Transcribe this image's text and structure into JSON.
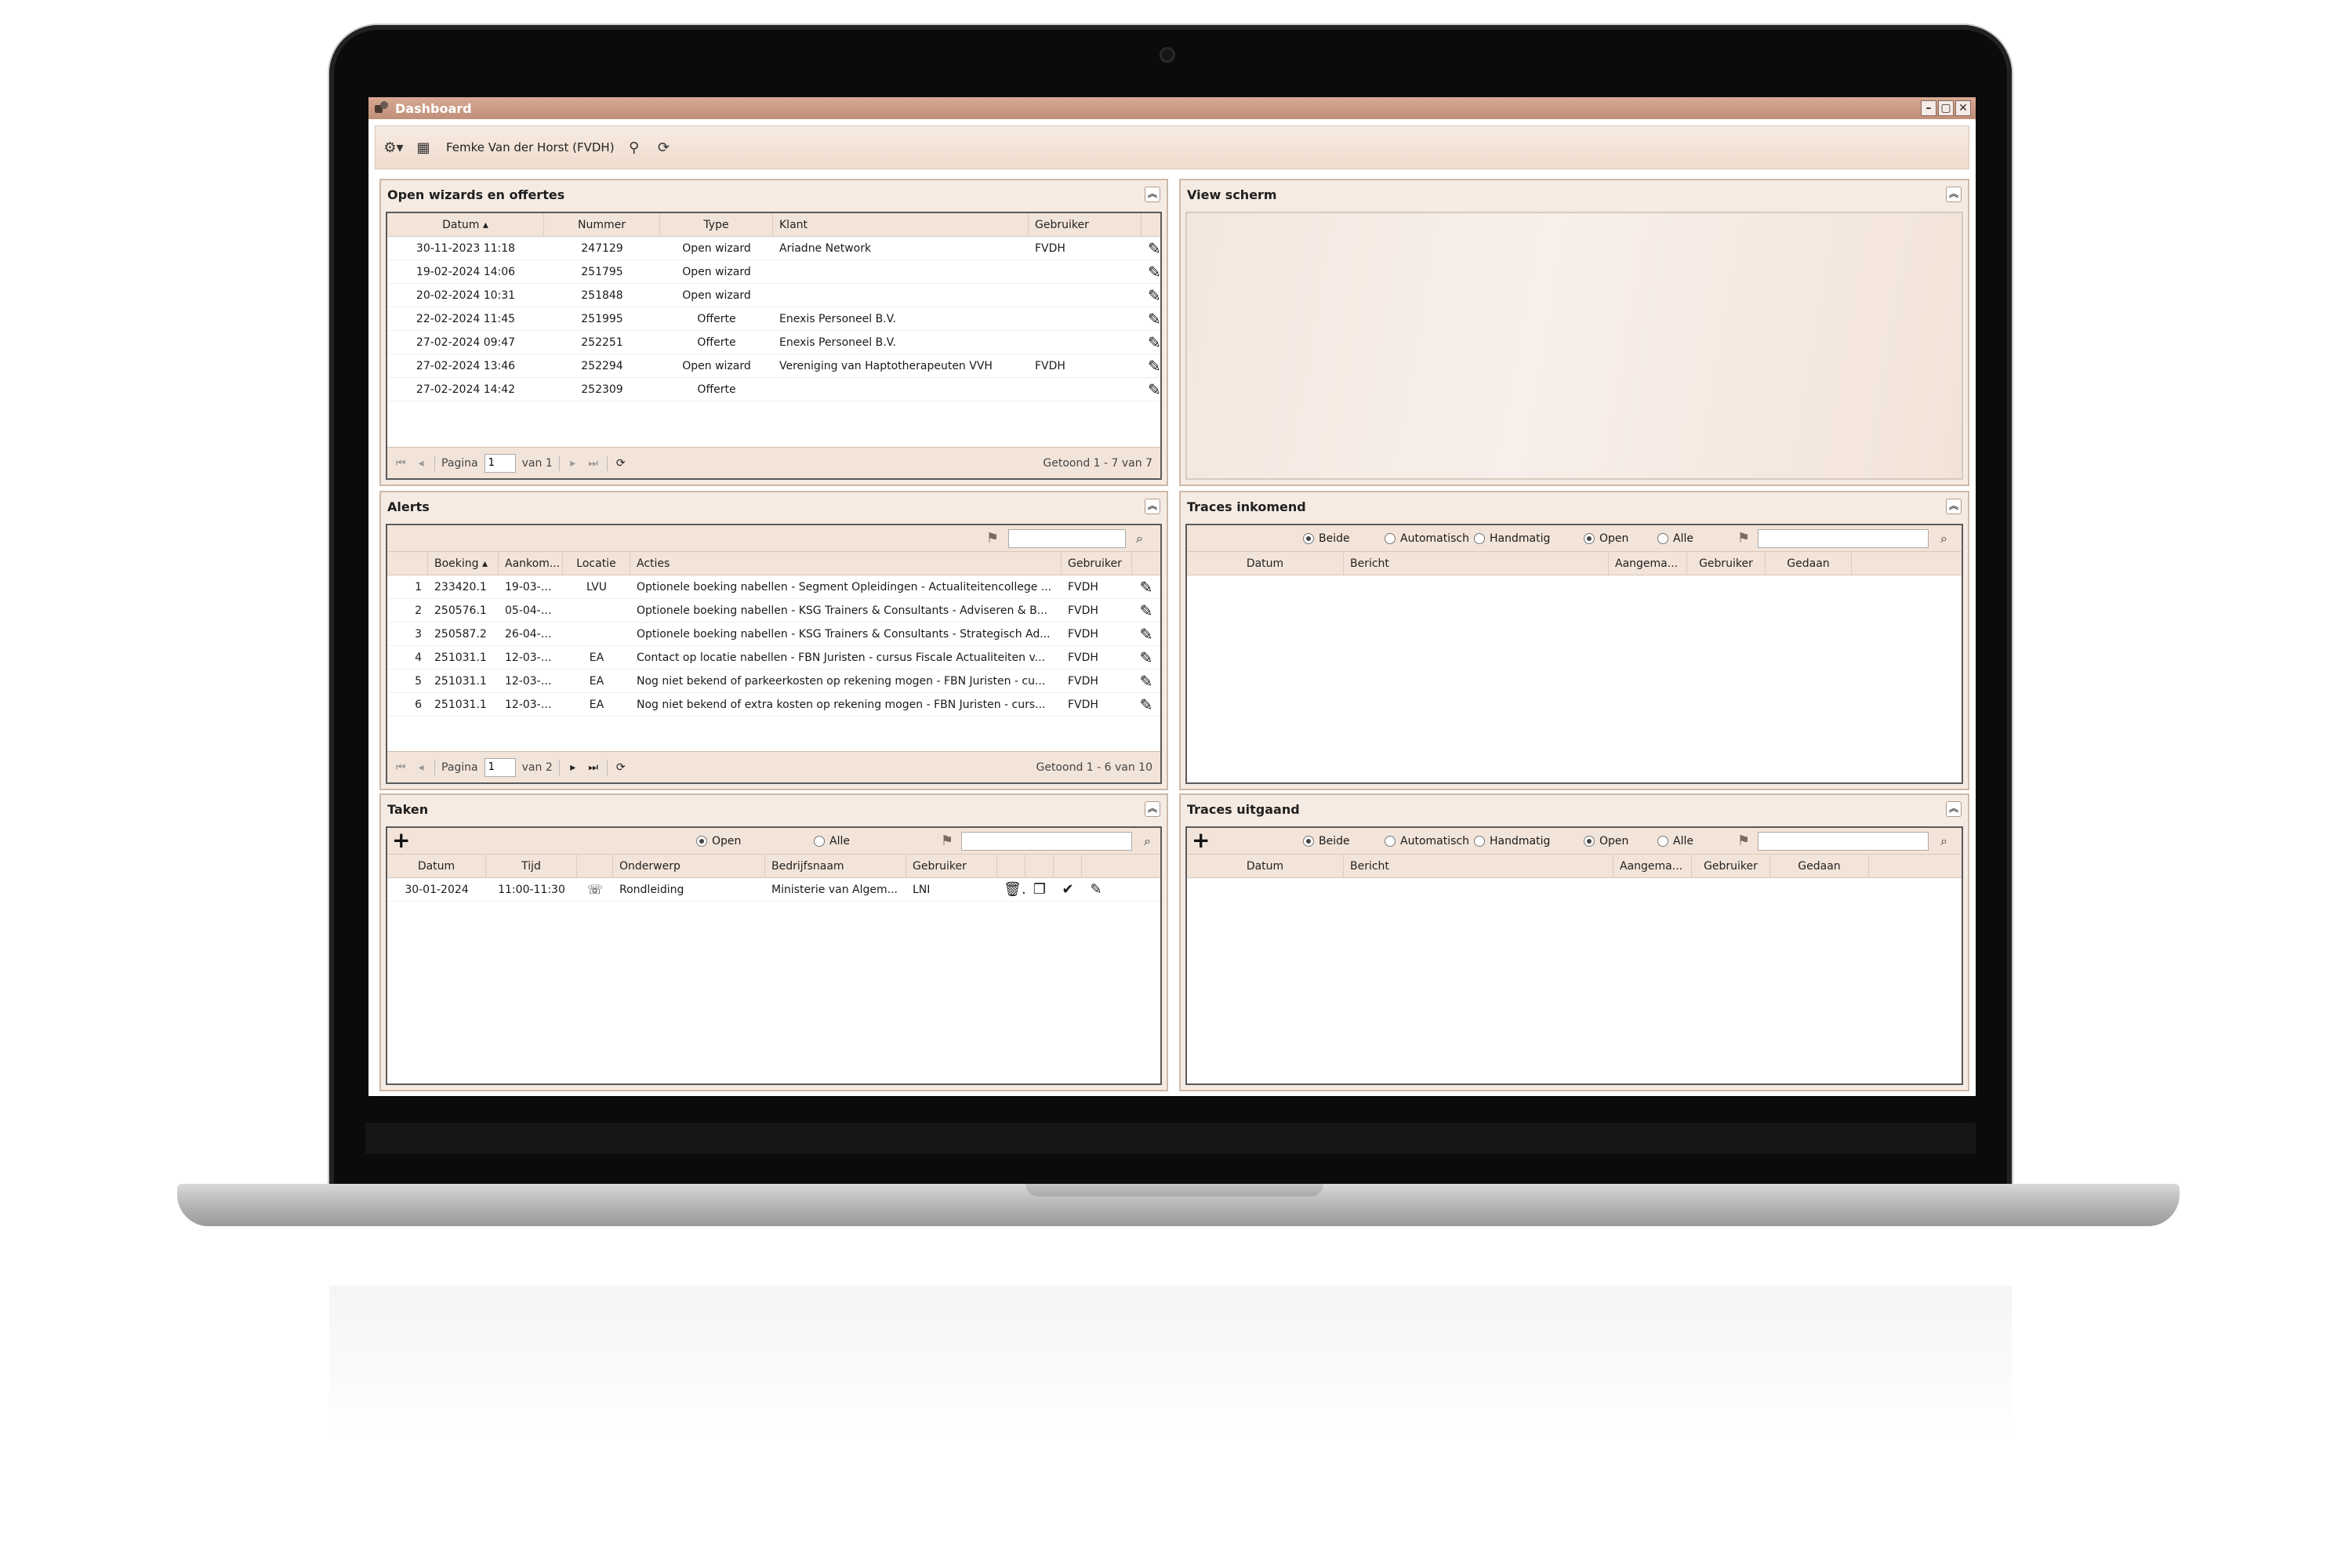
{
  "window": {
    "title": "Dashboard",
    "buttons": [
      "–",
      "▢",
      "✕"
    ]
  },
  "toolbar": {
    "user": "Femke Van der Horst (FVDH)",
    "icons": [
      "gear-icon",
      "grid-icon",
      "search-user-icon",
      "refresh-icon"
    ]
  },
  "panels": {
    "wizards": {
      "title": "Open wizards en offertes",
      "columns": [
        "Datum",
        "Nummer",
        "Type",
        "Klant",
        "Gebruiker"
      ],
      "rows": [
        {
          "datum": "30-11-2023 11:18",
          "nummer": "247129",
          "type": "Open wizard",
          "klant": "Ariadne Network",
          "gebruiker": "FVDH"
        },
        {
          "datum": "19-02-2024 14:06",
          "nummer": "251795",
          "type": "Open wizard",
          "klant": "",
          "gebruiker": ""
        },
        {
          "datum": "20-02-2024 10:31",
          "nummer": "251848",
          "type": "Open wizard",
          "klant": "",
          "gebruiker": ""
        },
        {
          "datum": "22-02-2024 11:45",
          "nummer": "251995",
          "type": "Offerte",
          "klant": "Enexis Personeel B.V.",
          "gebruiker": ""
        },
        {
          "datum": "27-02-2024 09:47",
          "nummer": "252251",
          "type": "Offerte",
          "klant": "Enexis Personeel B.V.",
          "gebruiker": ""
        },
        {
          "datum": "27-02-2024 13:46",
          "nummer": "252294",
          "type": "Open wizard",
          "klant": "Vereniging van Haptotherapeuten VVH",
          "gebruiker": "FVDH"
        },
        {
          "datum": "27-02-2024 14:42",
          "nummer": "252309",
          "type": "Offerte",
          "klant": "",
          "gebruiker": ""
        }
      ],
      "pager": {
        "label": "Pagina",
        "page": "1",
        "of": "van 1",
        "shown": "Getoond 1 - 7 van 7"
      }
    },
    "view": {
      "title": "View scherm"
    },
    "alerts": {
      "title": "Alerts",
      "columns": [
        "Boeking",
        "Aankom...",
        "Locatie",
        "Acties",
        "Gebruiker"
      ],
      "rows": [
        {
          "n": "1",
          "boeking": "233420.1",
          "aankomst": "19-03-2...",
          "locatie": "LVU",
          "acties": "Optionele boeking nabellen - Segment Opleidingen - Actualiteitencollege ...",
          "gebruiker": "FVDH"
        },
        {
          "n": "2",
          "boeking": "250576.1",
          "aankomst": "05-04-2...",
          "locatie": "",
          "acties": "Optionele boeking nabellen - KSG Trainers & Consultants - Adviseren & B...",
          "gebruiker": "FVDH"
        },
        {
          "n": "3",
          "boeking": "250587.2",
          "aankomst": "26-04-2...",
          "locatie": "",
          "acties": "Optionele boeking nabellen - KSG Trainers & Consultants - Strategisch Ad...",
          "gebruiker": "FVDH"
        },
        {
          "n": "4",
          "boeking": "251031.1",
          "aankomst": "12-03-2...",
          "locatie": "EA",
          "acties": "Contact op locatie nabellen - FBN Juristen - cursus Fiscale Actualiteiten v...",
          "gebruiker": "FVDH"
        },
        {
          "n": "5",
          "boeking": "251031.1",
          "aankomst": "12-03-2...",
          "locatie": "EA",
          "acties": "Nog niet bekend of parkeerkosten op rekening mogen - FBN Juristen - cu...",
          "gebruiker": "FVDH"
        },
        {
          "n": "6",
          "boeking": "251031.1",
          "aankomst": "12-03-2...",
          "locatie": "EA",
          "acties": "Nog niet bekend of extra kosten op rekening mogen - FBN Juristen - curs...",
          "gebruiker": "FVDH"
        }
      ],
      "pager": {
        "label": "Pagina",
        "page": "1",
        "of": "van 2",
        "shown": "Getoond 1 - 6 van 10"
      }
    },
    "traces_in": {
      "title": "Traces inkomend",
      "radios": [
        "Beide",
        "Automatisch",
        "Handmatig",
        "Open",
        "Alle"
      ],
      "columns": [
        "Datum",
        "Bericht",
        "Aangema...",
        "Gebruiker",
        "Gedaan"
      ]
    },
    "taken": {
      "title": "Taken",
      "radios": [
        "Open",
        "Alle"
      ],
      "columns": [
        "Datum",
        "Tijd",
        "Onderwerp",
        "Bedrijfsnaam",
        "Gebruiker"
      ],
      "rows": [
        {
          "datum": "30-01-2024",
          "tijd": "11:00-11:30",
          "onderwerp": "Rondleiding",
          "bedrijf": "Ministerie van Algem...",
          "gebruiker": "LNI"
        }
      ]
    },
    "traces_out": {
      "title": "Traces uitgaand",
      "radios": [
        "Beide",
        "Automatisch",
        "Handmatig",
        "Open",
        "Alle"
      ],
      "columns": [
        "Datum",
        "Bericht",
        "Aangema...",
        "Gebruiker",
        "Gedaan"
      ]
    }
  }
}
